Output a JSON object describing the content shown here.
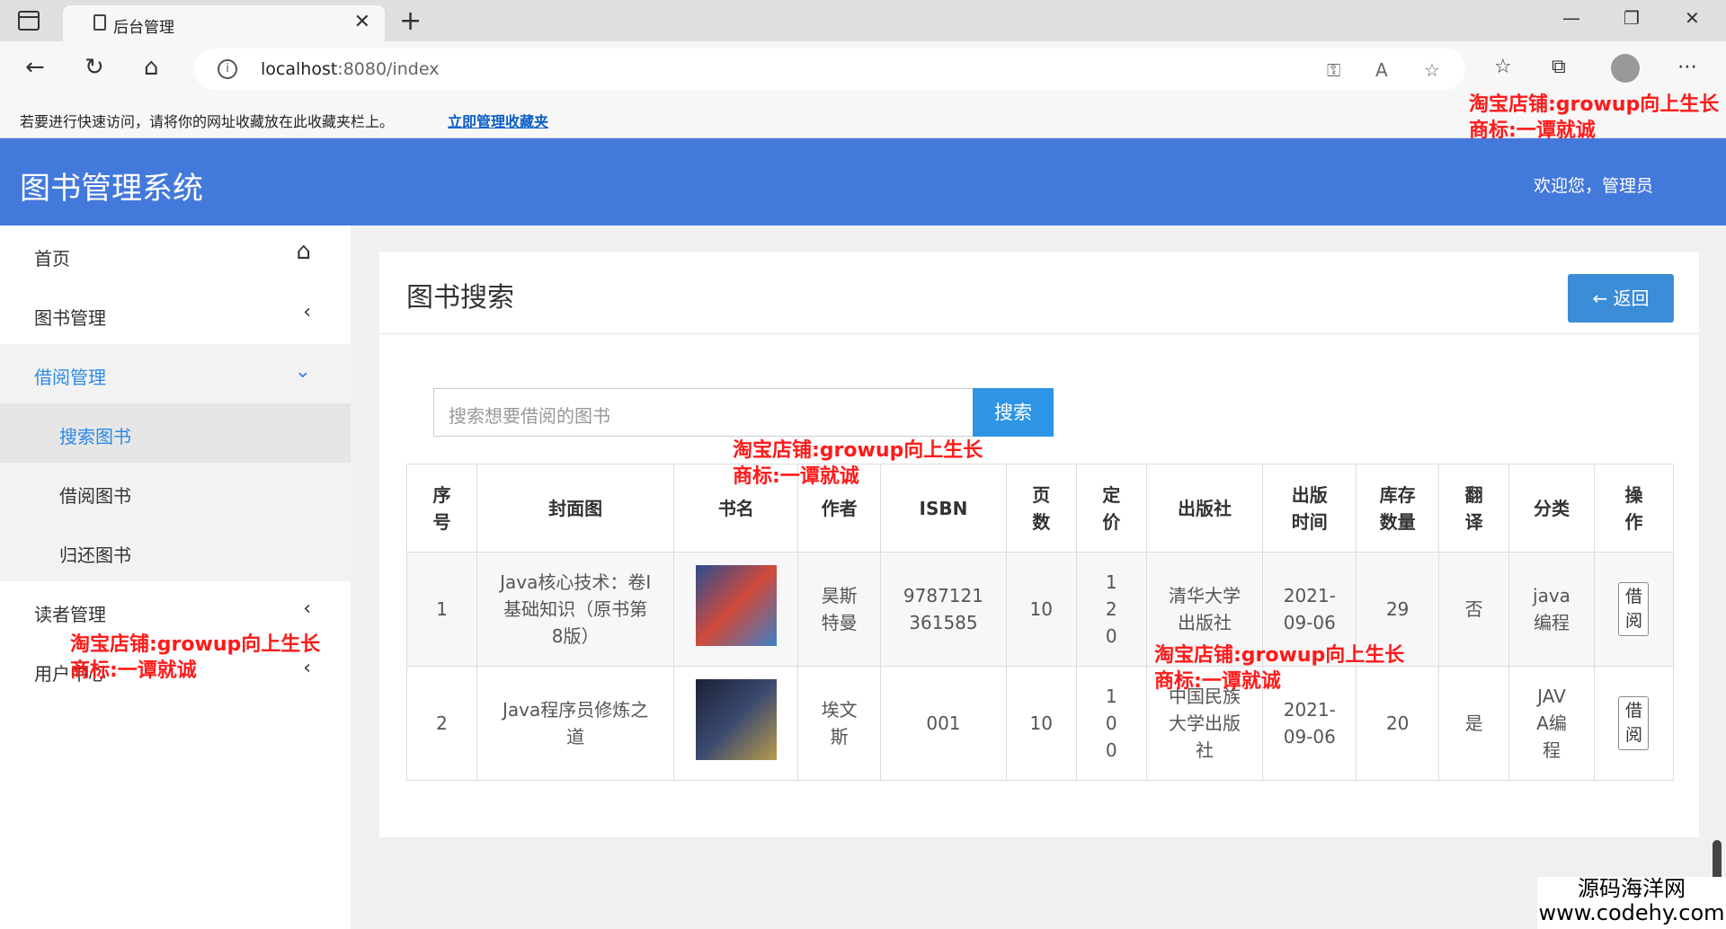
{
  "browser": {
    "tab_title": "后台管理",
    "url_host": "localhost",
    "url_rest": ":8080/index",
    "favorites_hint": "若要进行快速访问，请将你的网址收藏放在此收藏夹栏上。",
    "favorites_link": "立即管理收藏夹"
  },
  "header": {
    "title": "图书管理系统",
    "welcome": "欢迎您，管理员"
  },
  "sidebar": {
    "items": [
      {
        "label": "首页"
      },
      {
        "label": "图书管理"
      },
      {
        "label": "借阅管理"
      },
      {
        "label": "搜索图书"
      },
      {
        "label": "借阅图书"
      },
      {
        "label": "归还图书"
      },
      {
        "label": "读者管理"
      },
      {
        "label": "用户中心"
      }
    ]
  },
  "main": {
    "title": "图书搜索",
    "back_label": "返回",
    "search_placeholder": "搜索想要借阅的图书",
    "search_button": "搜索",
    "table": {
      "headers": [
        "序号",
        "封面图",
        "书名",
        "作者",
        "ISBN",
        "页数",
        "定价",
        "出版社",
        "出版时间",
        "库存数量",
        "翻译",
        "分类",
        "操作"
      ],
      "rows": [
        {
          "no": "1",
          "cover_name": "Java核心技术：卷Ⅰ基础知识（原书第8版）",
          "author": "昊斯特曼",
          "isbn": "9787121361585",
          "pages": "10",
          "price": "120",
          "publisher": "清华大学出版社",
          "date": "2021-09-06",
          "stock": "29",
          "translated": "否",
          "category": "java编程",
          "action": "借阅"
        },
        {
          "no": "2",
          "cover_name": "Java程序员修炼之道",
          "author": "埃文斯",
          "isbn": "001",
          "pages": "10",
          "price": "100",
          "publisher": "中国民族大学出版社",
          "date": "2021-09-06",
          "stock": "20",
          "translated": "是",
          "category": "JAVA编程",
          "action": "借阅"
        }
      ]
    }
  },
  "watermarks": {
    "shop": "淘宝店铺:growup向上生长",
    "brand": "商标:一谭就诚",
    "site_name": "源码海洋网",
    "site_url": "www.codehy.com"
  }
}
